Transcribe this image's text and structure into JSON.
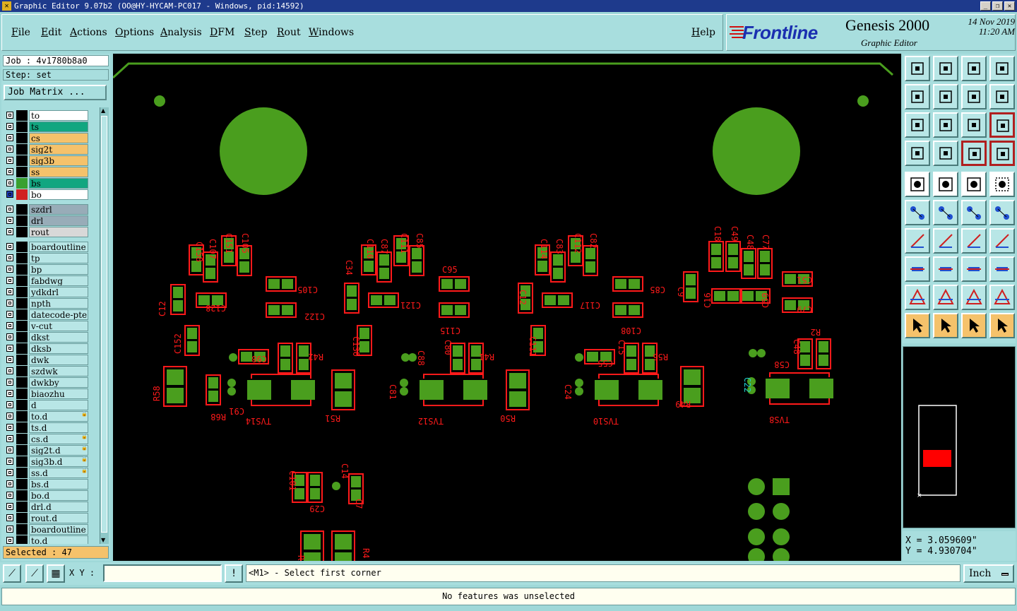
{
  "window": {
    "title": "Graphic Editor 9.07b2 (OO@HY-HYCAM-PC017 - Windows, pid:14592)"
  },
  "menu": {
    "items": [
      "File",
      "Edit",
      "Actions",
      "Options",
      "Analysis",
      "DFM",
      "Step",
      "Rout",
      "Windows"
    ],
    "help": "Help"
  },
  "brand": {
    "logo": "Frontline",
    "product": "Genesis 2000",
    "subtitle": "Graphic Editor",
    "date": "14 Nov 2019",
    "time": "11:20 AM"
  },
  "job": {
    "job_label": "Job : 4v1780b8a0",
    "step_label": "Step: set",
    "matrix_button": "Job Matrix ..."
  },
  "layers": [
    {
      "name": "to",
      "color": "#ffffff",
      "swatch": "#000000"
    },
    {
      "name": "ts",
      "color": "#11a680",
      "swatch": "#000000"
    },
    {
      "name": "cs",
      "color": "#f5c26b",
      "swatch": "#000000"
    },
    {
      "name": "sig2t",
      "color": "#f5c26b",
      "swatch": "#000000"
    },
    {
      "name": "sig3b",
      "color": "#f5c26b",
      "swatch": "#000000"
    },
    {
      "name": "ss",
      "color": "#f5c26b",
      "swatch": "#000000"
    },
    {
      "name": "bs",
      "color": "#11a680",
      "swatch": "#3aa030"
    },
    {
      "name": "bo",
      "color": "#ffffff",
      "swatch": "#d02020"
    },
    {
      "name": "szdrl",
      "color": "#98acb8",
      "swatch": "#000000"
    },
    {
      "name": "drl",
      "color": "#98acb8",
      "swatch": "#000000"
    },
    {
      "name": "rout",
      "color": "#d8d8d8",
      "swatch": "#000000"
    },
    {
      "name": "boardoutline",
      "color": "#b8e6e6",
      "swatch": "#000000"
    },
    {
      "name": "tp",
      "color": "#b8e6e6",
      "swatch": "#000000"
    },
    {
      "name": "bp",
      "color": "#b8e6e6",
      "swatch": "#000000"
    },
    {
      "name": "fabdwg",
      "color": "#b8e6e6",
      "swatch": "#000000"
    },
    {
      "name": "ydkdrl",
      "color": "#b8e6e6",
      "swatch": "#000000"
    },
    {
      "name": "npth",
      "color": "#b8e6e6",
      "swatch": "#000000"
    },
    {
      "name": "datecode-pte",
      "color": "#b8e6e6",
      "swatch": "#000000"
    },
    {
      "name": "v-cut",
      "color": "#b8e6e6",
      "swatch": "#000000"
    },
    {
      "name": "dkst",
      "color": "#b8e6e6",
      "swatch": "#000000"
    },
    {
      "name": "dksb",
      "color": "#b8e6e6",
      "swatch": "#000000"
    },
    {
      "name": "dwk",
      "color": "#b8e6e6",
      "swatch": "#000000"
    },
    {
      "name": "szdwk",
      "color": "#b8e6e6",
      "swatch": "#000000"
    },
    {
      "name": "dwkby",
      "color": "#b8e6e6",
      "swatch": "#000000"
    },
    {
      "name": "biaozhu",
      "color": "#b8e6e6",
      "swatch": "#000000"
    },
    {
      "name": "d",
      "color": "#b8e6e6",
      "swatch": "#000000"
    },
    {
      "name": "to.d",
      "color": "#b8e6e6",
      "swatch": "#000000"
    },
    {
      "name": "ts.d",
      "color": "#b8e6e6",
      "swatch": "#000000"
    },
    {
      "name": "cs.d",
      "color": "#b8e6e6",
      "swatch": "#000000"
    },
    {
      "name": "sig2t.d",
      "color": "#b8e6e6",
      "swatch": "#000000"
    },
    {
      "name": "sig3b.d",
      "color": "#b8e6e6",
      "swatch": "#000000"
    },
    {
      "name": "ss.d",
      "color": "#b8e6e6",
      "swatch": "#000000"
    },
    {
      "name": "bs.d",
      "color": "#b8e6e6",
      "swatch": "#000000"
    },
    {
      "name": "bo.d",
      "color": "#b8e6e6",
      "swatch": "#000000"
    },
    {
      "name": "drl.d",
      "color": "#b8e6e6",
      "swatch": "#000000"
    },
    {
      "name": "rout.d",
      "color": "#b8e6e6",
      "swatch": "#000000"
    },
    {
      "name": "boardoutline",
      "color": "#b8e6e6",
      "swatch": "#000000"
    },
    {
      "name": "to.d",
      "color": "#b8e6e6",
      "swatch": "#000000"
    }
  ],
  "selected": "Selected : 47",
  "canvas": {
    "refdes": [
      "C158",
      "C107",
      "C151",
      "C105",
      "C116",
      "C87",
      "C111",
      "C85",
      "C114",
      "C83",
      "C112",
      "C82",
      "C18",
      "C49",
      "C48",
      "C77",
      "C12",
      "C128",
      "C105",
      "C122",
      "C34",
      "C121",
      "C95",
      "C115",
      "C12",
      "C117",
      "C85",
      "C108",
      "C9",
      "C51",
      "C16",
      "C59",
      "C79",
      "C152",
      "C130",
      "C111",
      "C98",
      "R42",
      "C88",
      "C80",
      "R41",
      "C55",
      "C15",
      "R55",
      "C58",
      "C48",
      "R2",
      "R58",
      "C91",
      "R68",
      "TVS14",
      "R51",
      "C81",
      "TVS12",
      "R50",
      "C24",
      "TVS10",
      "R49",
      "C22",
      "TVS8",
      "C101",
      "C14",
      "C29",
      "C7"
    ],
    "highlight_color": "#20d0d0"
  },
  "coords": {
    "x": "X = 3.059609\"",
    "y": "Y = 4.930704\""
  },
  "command": {
    "xy_label": "X Y :",
    "xy_value": "",
    "prompt": "<M1> - Select first corner",
    "unit": "Inch"
  },
  "status": "No features was unselected"
}
